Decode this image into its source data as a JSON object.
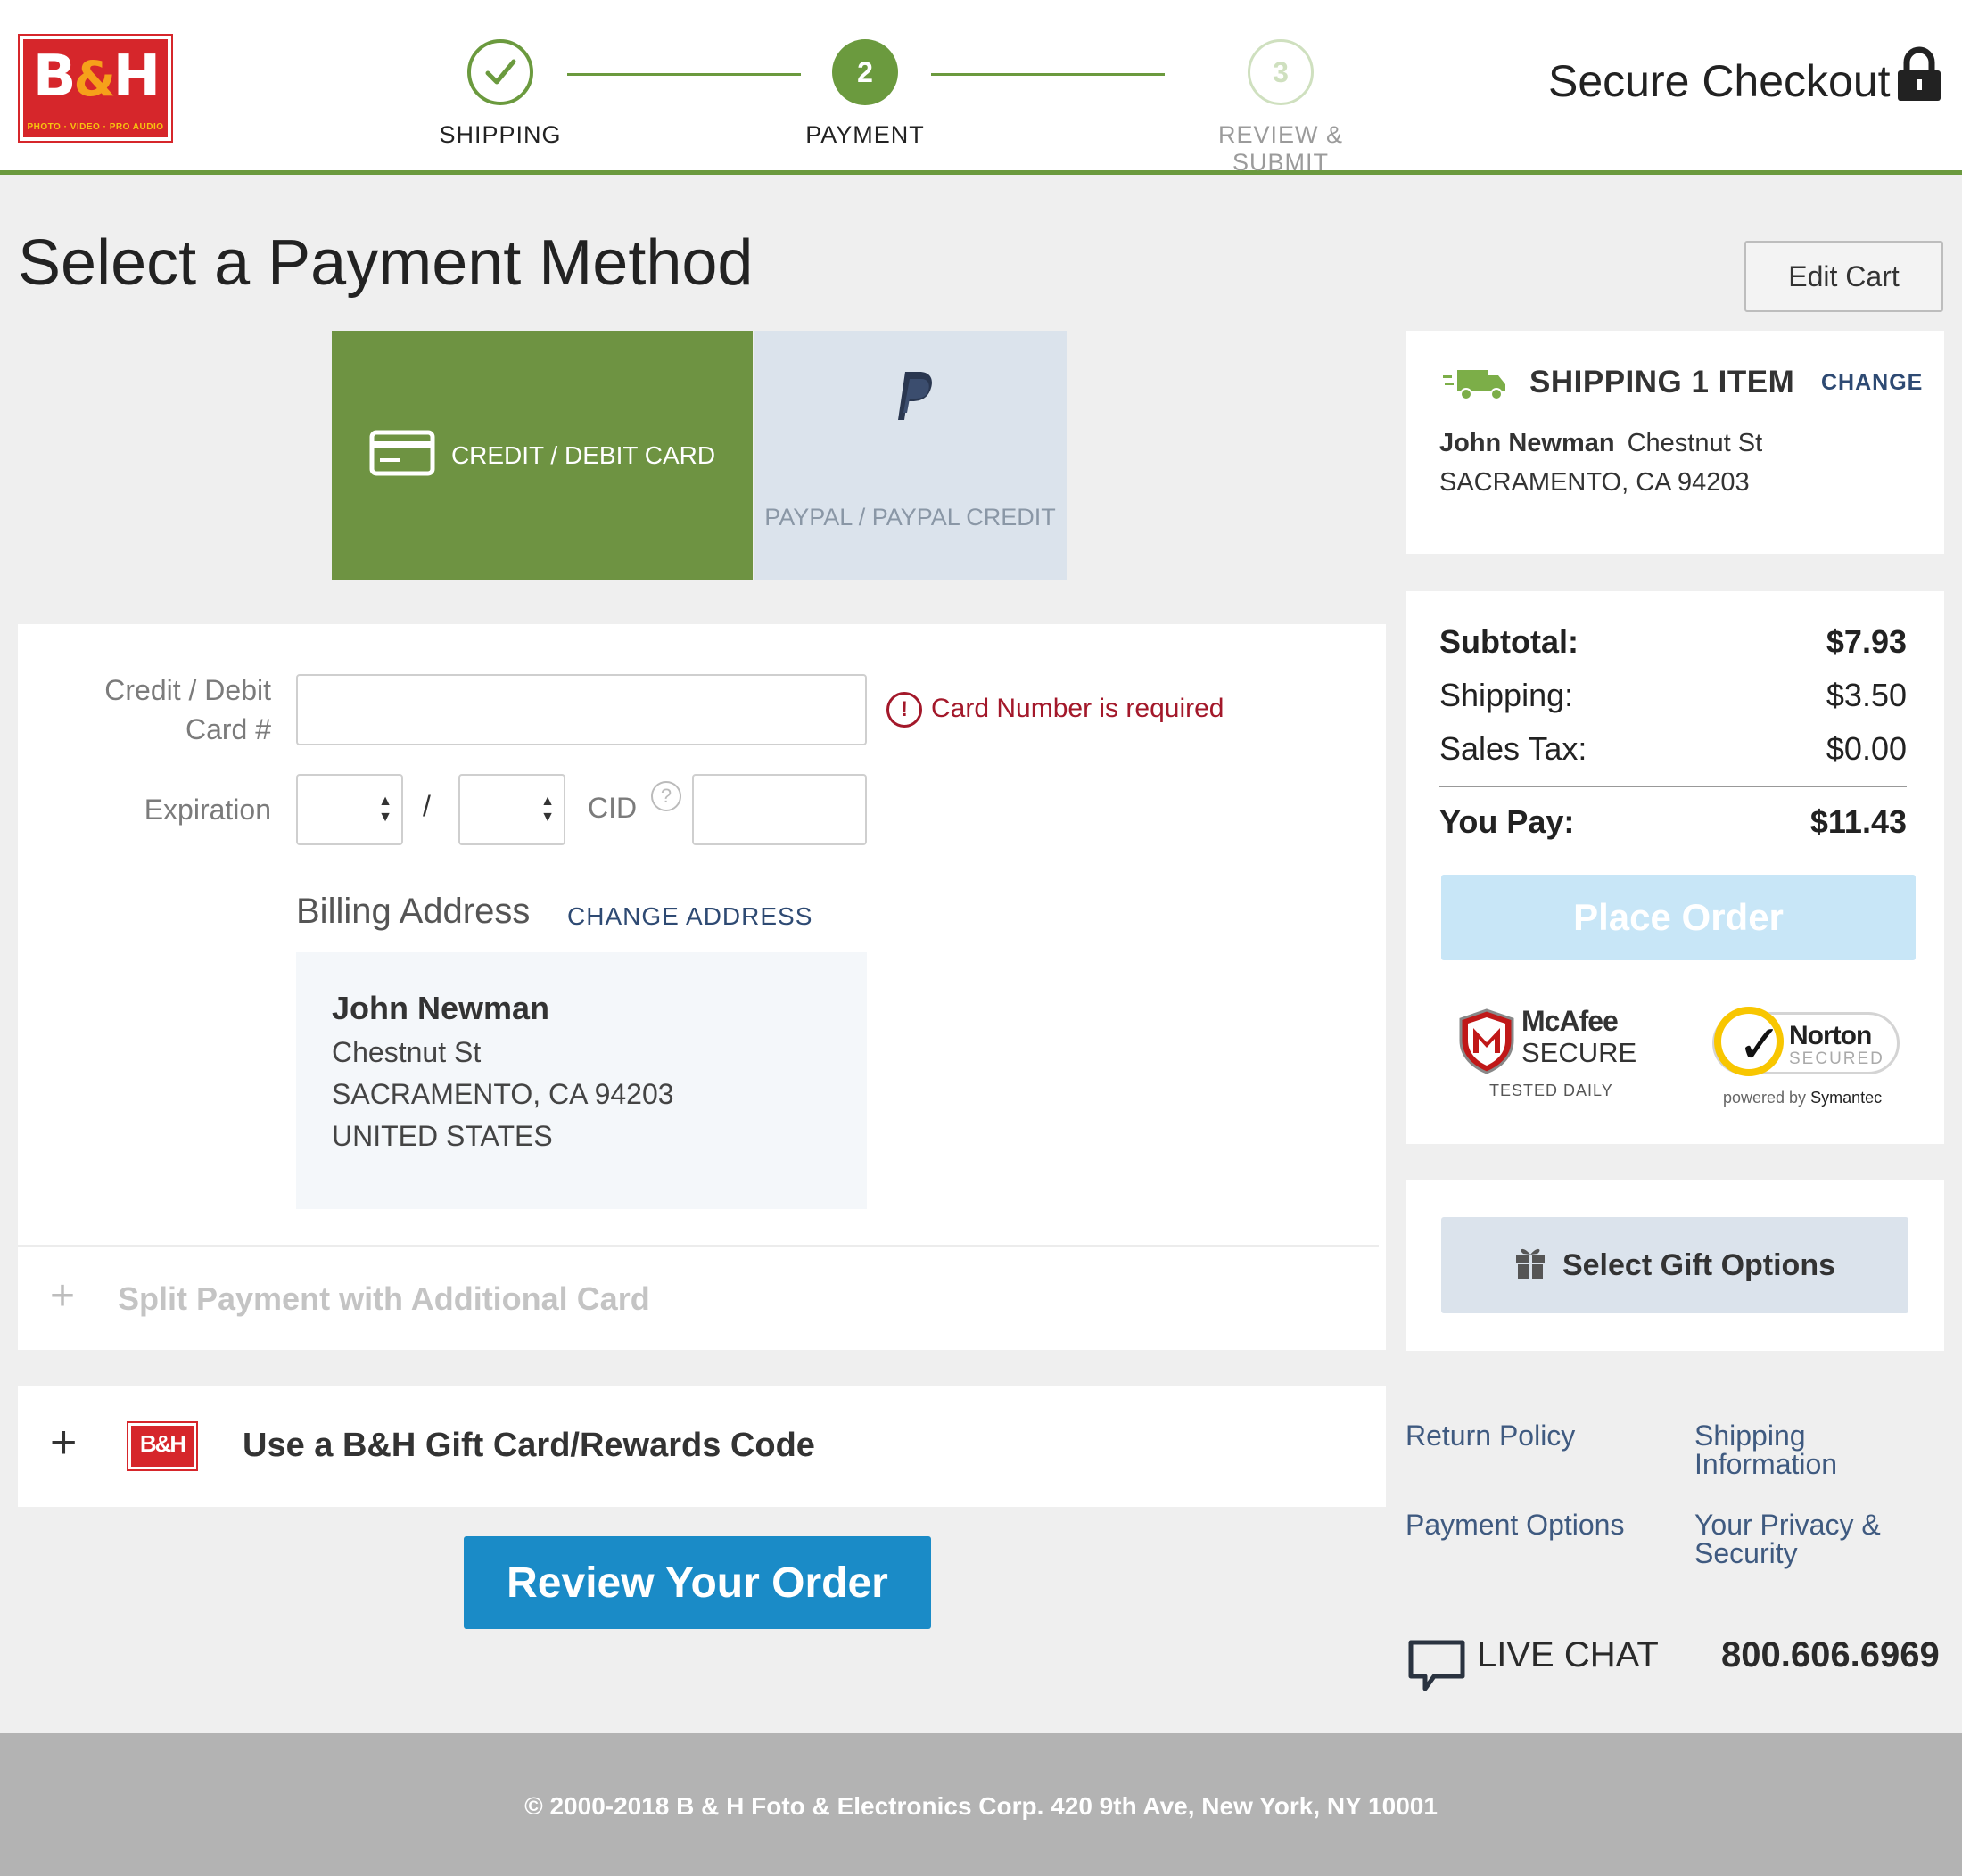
{
  "brand": {
    "logo_text": "B&H",
    "logo_tagline": "PHOTO · VIDEO · PRO AUDIO",
    "accent": "#6b9a3e",
    "red": "#d6262b"
  },
  "steps": [
    {
      "label": "SHIPPING",
      "state": "done",
      "icon": "check-icon"
    },
    {
      "label": "PAYMENT",
      "number": "2",
      "state": "current"
    },
    {
      "label": "REVIEW & SUBMIT",
      "number": "3",
      "state": "upcoming"
    }
  ],
  "header": {
    "secure_text": "Secure Checkout",
    "icon": "lock-icon"
  },
  "page": {
    "title": "Select a Payment Method",
    "edit_cart": "Edit Cart"
  },
  "payment_tabs": {
    "credit": {
      "label": "CREDIT / DEBIT CARD",
      "selected": true,
      "icon": "credit-card-icon"
    },
    "paypal": {
      "label": "PAYPAL / PAYPAL CREDIT",
      "selected": false,
      "icon": "paypal-icon"
    }
  },
  "form": {
    "card_label_line1": "Credit / Debit",
    "card_label_line2": "Card #",
    "card_value": "",
    "card_error": "Card Number is required",
    "expiration_label": "Expiration",
    "month_value": "",
    "year_value": "",
    "separator": "/",
    "cid_label": "CID",
    "cid_help": "?",
    "cid_value": "",
    "billing_title": "Billing Address",
    "change_address": "CHANGE ADDRESS",
    "address": {
      "name": "John Newman",
      "street": "Chestnut St",
      "city": "SACRAMENTO, CA 94203",
      "country": "UNITED STATES"
    },
    "split_payment": "Split Payment with Additional Card"
  },
  "gift_card": {
    "label": "Use a B&H Gift Card/Rewards Code",
    "mini_logo": "B&H"
  },
  "review_button": "Review Your Order",
  "shipping": {
    "title": "SHIPPING 1 ITEM",
    "change": "CHANGE",
    "name": "John Newman",
    "street": "Chestnut St",
    "city": "SACRAMENTO, CA 94203"
  },
  "summary": {
    "subtotal_label": "Subtotal:",
    "subtotal": "$7.93",
    "shipping_label": "Shipping:",
    "shipping": "$3.50",
    "tax_label": "Sales Tax:",
    "tax": "$0.00",
    "pay_label": "You Pay:",
    "pay": "$11.43",
    "place_order": "Place Order"
  },
  "badges": {
    "mcafee_name": "McAfee",
    "mcafee_secure": "SECURE",
    "mcafee_tested": "TESTED DAILY",
    "norton_name": "Norton",
    "norton_secured": "SECURED",
    "norton_powered": "powered by",
    "norton_symantec": "Symantec"
  },
  "gift_options": {
    "label": "Select Gift Options",
    "icon": "gift-icon"
  },
  "links": {
    "return_policy": "Return Policy",
    "shipping_info_1": "Shipping",
    "shipping_info_2": "Information",
    "payment_options": "Payment Options",
    "privacy_1": "Your Privacy &",
    "privacy_2": "Security"
  },
  "contact": {
    "live_chat": "LIVE CHAT",
    "phone": "800.606.6969"
  },
  "footer": {
    "copyright": "© 2000-2018 B & H Foto & Electronics Corp. 420 9th Ave, New York, NY 10001"
  }
}
